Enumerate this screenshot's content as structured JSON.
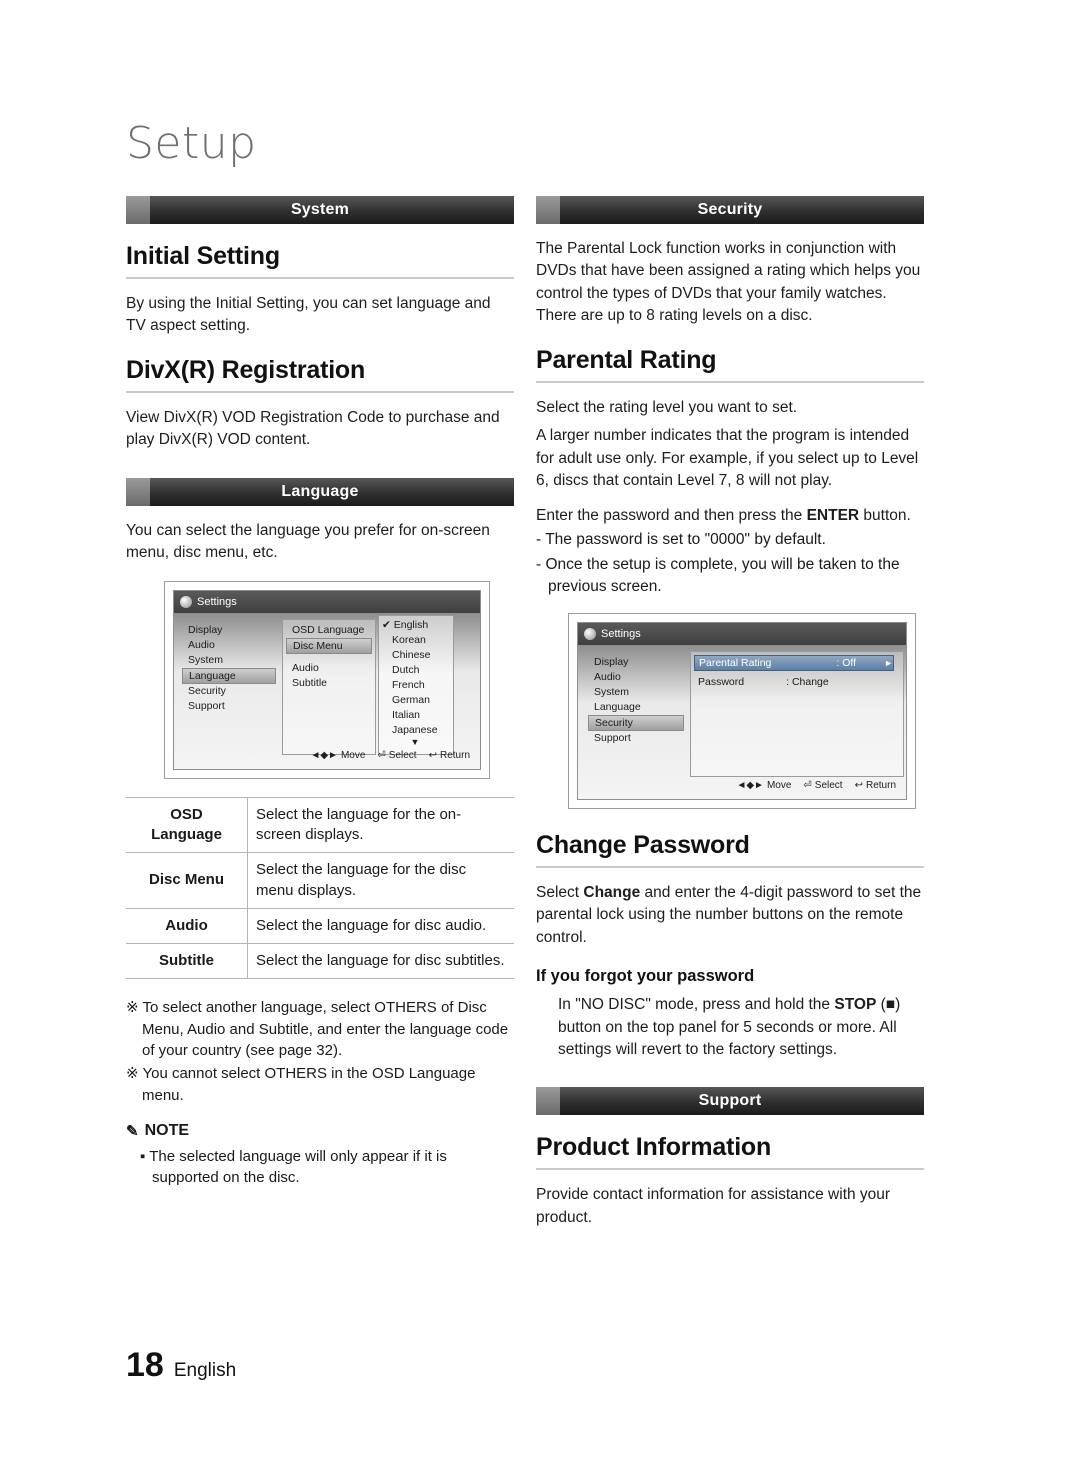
{
  "page": {
    "title": "Setup",
    "number": "18",
    "language": "English"
  },
  "left": {
    "section_system": "System",
    "initial_setting": {
      "heading": "Initial Setting",
      "body": "By using the Initial Setting, you can set language and TV aspect setting."
    },
    "divx": {
      "heading": "DivX(R) Registration",
      "body": "View DivX(R) VOD Registration Code to purchase and play DivX(R) VOD content."
    },
    "section_language": "Language",
    "language_body": "You can select the language you prefer for on-screen menu, disc menu, etc.",
    "osd_language": {
      "titlebar": "Settings",
      "menu": [
        "Display",
        "Audio",
        "System",
        "Language",
        "Security",
        "Support"
      ],
      "menu_selected": "Language",
      "submenu": [
        "OSD Language",
        "Disc Menu",
        "Audio",
        "Subtitle"
      ],
      "submenu_selected": "Disc Menu",
      "languages": [
        "English",
        "Korean",
        "Chinese",
        "Dutch",
        "French",
        "German",
        "Italian",
        "Japanese"
      ],
      "language_checked": "English",
      "footer_move": "Move",
      "footer_select": "Select",
      "footer_return": "Return"
    },
    "table": {
      "rows": [
        {
          "key": "OSD Language",
          "value": "Select the language for the on-screen displays."
        },
        {
          "key": "Disc Menu",
          "value": "Select the language for the disc menu displays."
        },
        {
          "key": "Audio",
          "value": "Select the language for disc audio."
        },
        {
          "key": "Subtitle",
          "value": "Select the language for disc subtitles."
        }
      ]
    },
    "notes": [
      "To select another language, select OTHERS of Disc Menu, Audio and Subtitle, and enter the language code of your country (see page 32).",
      "You cannot select OTHERS in the OSD Language menu."
    ],
    "note_box": {
      "title": "NOTE",
      "text": "The selected language will only appear if it is supported on the disc."
    }
  },
  "right": {
    "section_security": "Security",
    "security_body": "The Parental Lock function works in conjunction with DVDs that have been assigned a rating which helps you control the types of DVDs that your family watches. There are up to 8 rating levels on a disc.",
    "parental_rating": {
      "heading": "Parental Rating",
      "p1": "Select the rating level you want to set.",
      "p2": "A larger number indicates that the program is intended for adult use only. For example, if you select up to Level 6, discs that contain Level 7, 8 will not play.",
      "p3_prefix": "Enter the password and then press the ",
      "p3_bold": "ENTER",
      "p3_suffix": " button.",
      "bullet1": "- The password is set to \"0000\" by default.",
      "bullet2": "- Once the setup is complete, you will be taken to the previous screen."
    },
    "osd_security": {
      "titlebar": "Settings",
      "menu": [
        "Display",
        "Audio",
        "System",
        "Language",
        "Security",
        "Support"
      ],
      "menu_selected": "Security",
      "rows": [
        {
          "label": "Parental Rating",
          "value": ": Off"
        },
        {
          "label": "Password",
          "value": ": Change"
        }
      ],
      "row_selected": "Parental Rating",
      "footer_move": "Move",
      "footer_select": "Select",
      "footer_return": "Return"
    },
    "change_password": {
      "heading": "Change Password",
      "body_prefix": "Select ",
      "body_bold": "Change",
      "body_suffix": " and enter the 4-digit password to set the parental lock using the number buttons on the remote control."
    },
    "forgot": {
      "heading": "If you forgot your password",
      "p_prefix": "In \"NO DISC\" mode, press and hold the ",
      "p_bold": "STOP",
      "p_suffix": " (■) button on the top panel for 5 seconds or more. All settings will revert to the factory settings."
    },
    "section_support": "Support",
    "product_information": {
      "heading": "Product Information",
      "body": "Provide contact information for assistance with your product."
    }
  }
}
